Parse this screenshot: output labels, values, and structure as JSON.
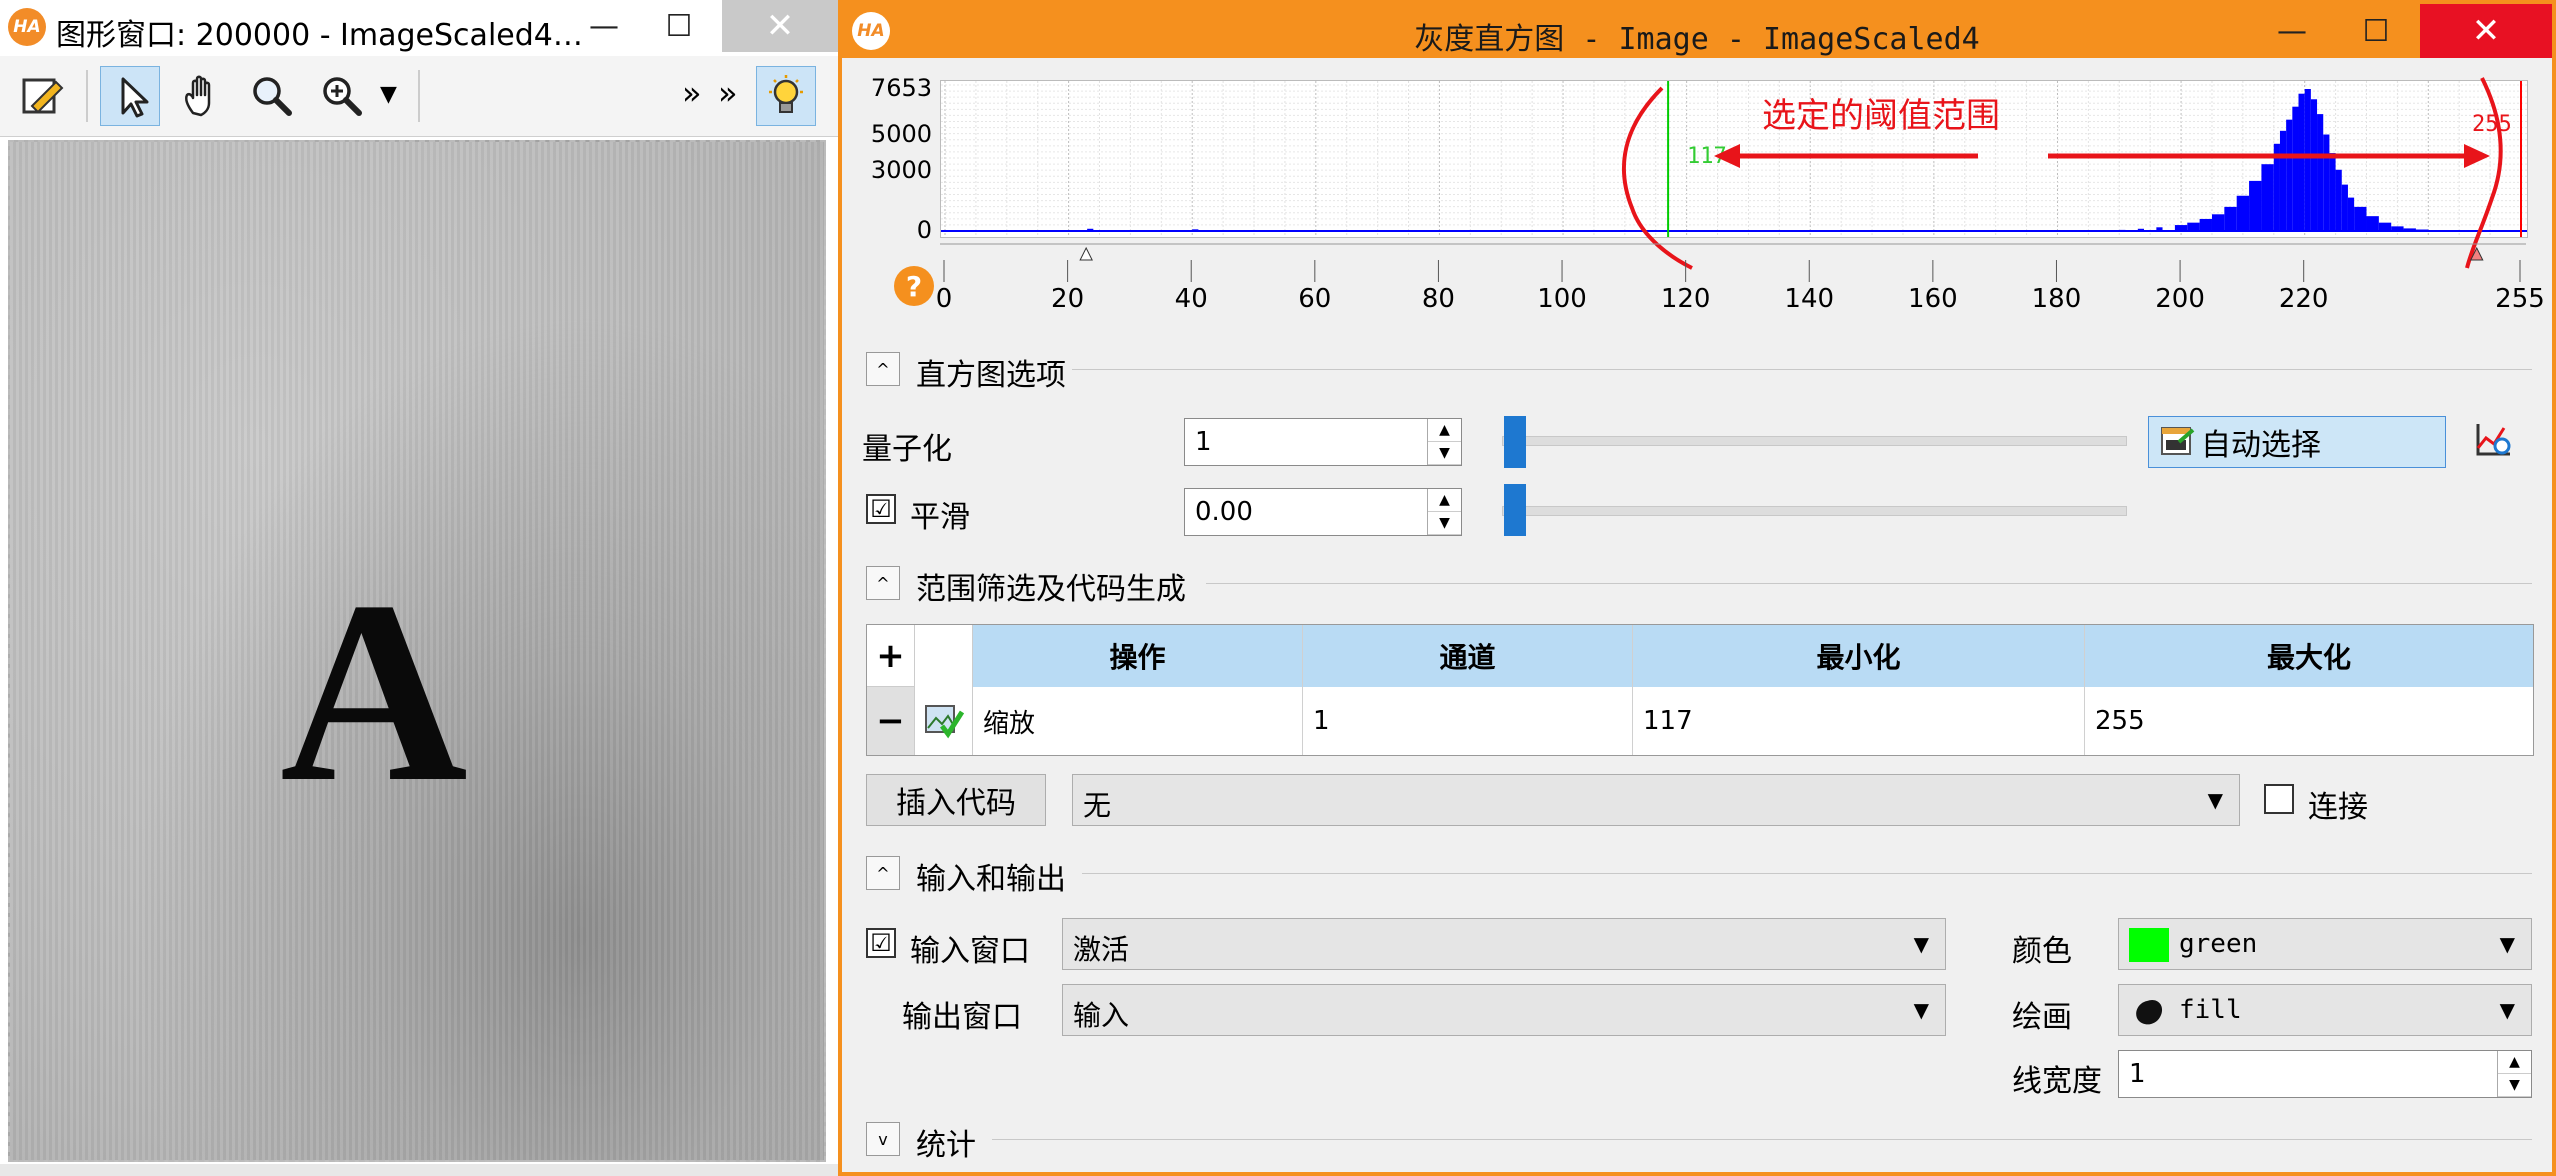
{
  "graphics_window": {
    "logo": "HA",
    "title": "图形窗口: 200000 - ImageScaled4…",
    "minimize": "—",
    "maximize": "☐",
    "close": "✕",
    "image_letter": "A",
    "toolbar_more_1": "»",
    "toolbar_more_2": "»"
  },
  "histogram_window": {
    "logo": "HA",
    "title": "灰度直方图 - Image - ImageScaled4",
    "minimize": "—",
    "maximize": "☐",
    "close": "✕",
    "help_symbol": "?",
    "annotation_text": "选定的阈值范围",
    "annotation_color": "#e8141a"
  },
  "chart_data": {
    "type": "bar",
    "title": "",
    "x_range": [
      0,
      255
    ],
    "x_ticks": [
      "0",
      "20",
      "40",
      "60",
      "80",
      "100",
      "120",
      "140",
      "160",
      "180",
      "200",
      "220",
      "255"
    ],
    "y_ticks": [
      "7653",
      "5000",
      "3000",
      "0"
    ],
    "y_range": [
      0,
      7653
    ],
    "bar_color": "#0000ff",
    "threshold_min": 117,
    "threshold_max": 255,
    "threshold_min_label": "117",
    "threshold_max_label": "255",
    "threshold_min_color": "#00cc00",
    "threshold_max_color": "#ff0000",
    "grid": true,
    "series": [
      {
        "x": 23,
        "y": 120
      },
      {
        "x": 40,
        "y": 90
      },
      {
        "x": 190,
        "y": 60
      },
      {
        "x": 193,
        "y": 120
      },
      {
        "x": 196,
        "y": 200
      },
      {
        "x": 199,
        "y": 320
      },
      {
        "x": 201,
        "y": 450
      },
      {
        "x": 203,
        "y": 650
      },
      {
        "x": 205,
        "y": 900
      },
      {
        "x": 207,
        "y": 1300
      },
      {
        "x": 209,
        "y": 1900
      },
      {
        "x": 211,
        "y": 2700
      },
      {
        "x": 213,
        "y": 3600
      },
      {
        "x": 215,
        "y": 4700
      },
      {
        "x": 216,
        "y": 5400
      },
      {
        "x": 217,
        "y": 6000
      },
      {
        "x": 218,
        "y": 6700
      },
      {
        "x": 219,
        "y": 7400
      },
      {
        "x": 220,
        "y": 7653
      },
      {
        "x": 221,
        "y": 7100
      },
      {
        "x": 222,
        "y": 6300
      },
      {
        "x": 223,
        "y": 5200
      },
      {
        "x": 224,
        "y": 4200
      },
      {
        "x": 225,
        "y": 3300
      },
      {
        "x": 226,
        "y": 2500
      },
      {
        "x": 227,
        "y": 1800
      },
      {
        "x": 228,
        "y": 1300
      },
      {
        "x": 230,
        "y": 800
      },
      {
        "x": 232,
        "y": 450
      },
      {
        "x": 234,
        "y": 250
      },
      {
        "x": 236,
        "y": 140
      },
      {
        "x": 238,
        "y": 80
      },
      {
        "x": 240,
        "y": 40
      }
    ]
  },
  "histogram_options": {
    "section_title": "直方图选项",
    "toggle": "^",
    "quantize_label": "量子化",
    "quantize_value": "1",
    "quantize_slider_value": 0,
    "smooth_label": "平滑",
    "smooth_checked": "☑",
    "smooth_value": "0.00",
    "smooth_slider_value": 0,
    "auto_select_label": "自动选择",
    "spin_up": "▲",
    "spin_down": "▼"
  },
  "range_filter": {
    "section_title": "范围筛选及代码生成",
    "toggle": "^",
    "add_symbol": "+",
    "remove_symbol": "−",
    "columns": [
      "操作",
      "通道",
      "最小化",
      "最大化"
    ],
    "rows": [
      {
        "operation": "缩放",
        "channel": "1",
        "min": "117",
        "max": "255"
      }
    ],
    "insert_code_label": "插入代码",
    "insert_code_option": "无",
    "connect_label": "连接"
  },
  "io": {
    "section_title": "输入和输出",
    "toggle": "^",
    "input_window_label": "输入窗口",
    "input_window_value": "激活",
    "output_window_label": "输出窗口",
    "output_window_value": "输入",
    "color_label": "颜色",
    "color_value": "green",
    "color_swatch": "#00ff00",
    "draw_label": "绘画",
    "draw_value": "fill",
    "line_width_label": "线宽度",
    "line_width_value": "1"
  },
  "stats": {
    "section_title": "统计",
    "toggle": "v"
  }
}
